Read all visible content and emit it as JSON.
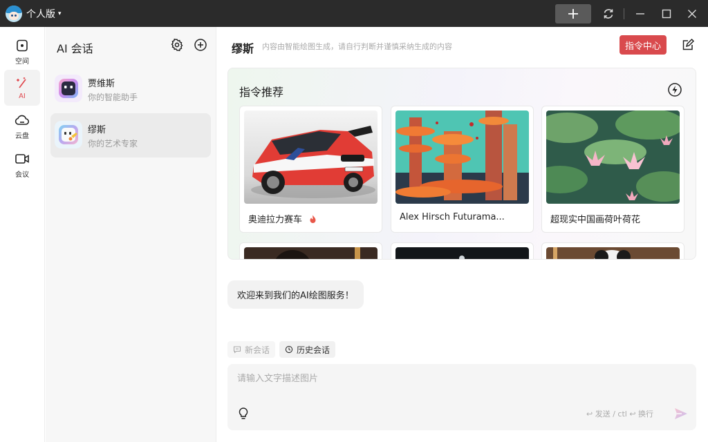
{
  "titlebar": {
    "user_name": "个人版",
    "caret": "▾"
  },
  "rail": {
    "items": [
      {
        "label": "空间",
        "icon": "space-icon"
      },
      {
        "label": "AI",
        "icon": "magic-wand-icon"
      },
      {
        "label": "云盘",
        "icon": "cloud-icon"
      },
      {
        "label": "会议",
        "icon": "video-icon"
      }
    ],
    "active_color": "#e0484e"
  },
  "conversations": {
    "title": "AI 会话",
    "items": [
      {
        "name": "贾维斯",
        "subtitle": "你的智能助手"
      },
      {
        "name": "缪斯",
        "subtitle": "你的艺术专家"
      }
    ]
  },
  "main": {
    "title": "缪斯",
    "subtitle": "内容由智能绘图生成，请自行判断并谨慎采纳生成的内容",
    "command_center": "指令中心",
    "recommend_title": "指令推荐",
    "cards": [
      {
        "label": "奥迪拉力赛车",
        "hot": true
      },
      {
        "label": "Alex Hirsch Futurama..."
      },
      {
        "label": "超现实中国画荷叶荷花"
      }
    ],
    "welcome": "欢迎来到我们的AI绘图服务！",
    "new_chat": "新会话",
    "history": "历史会话",
    "input_placeholder": "请输入文字描述图片",
    "hint": "↩ 发送 / ctl ↩ 换行",
    "accent_color": "#d94a4d"
  }
}
